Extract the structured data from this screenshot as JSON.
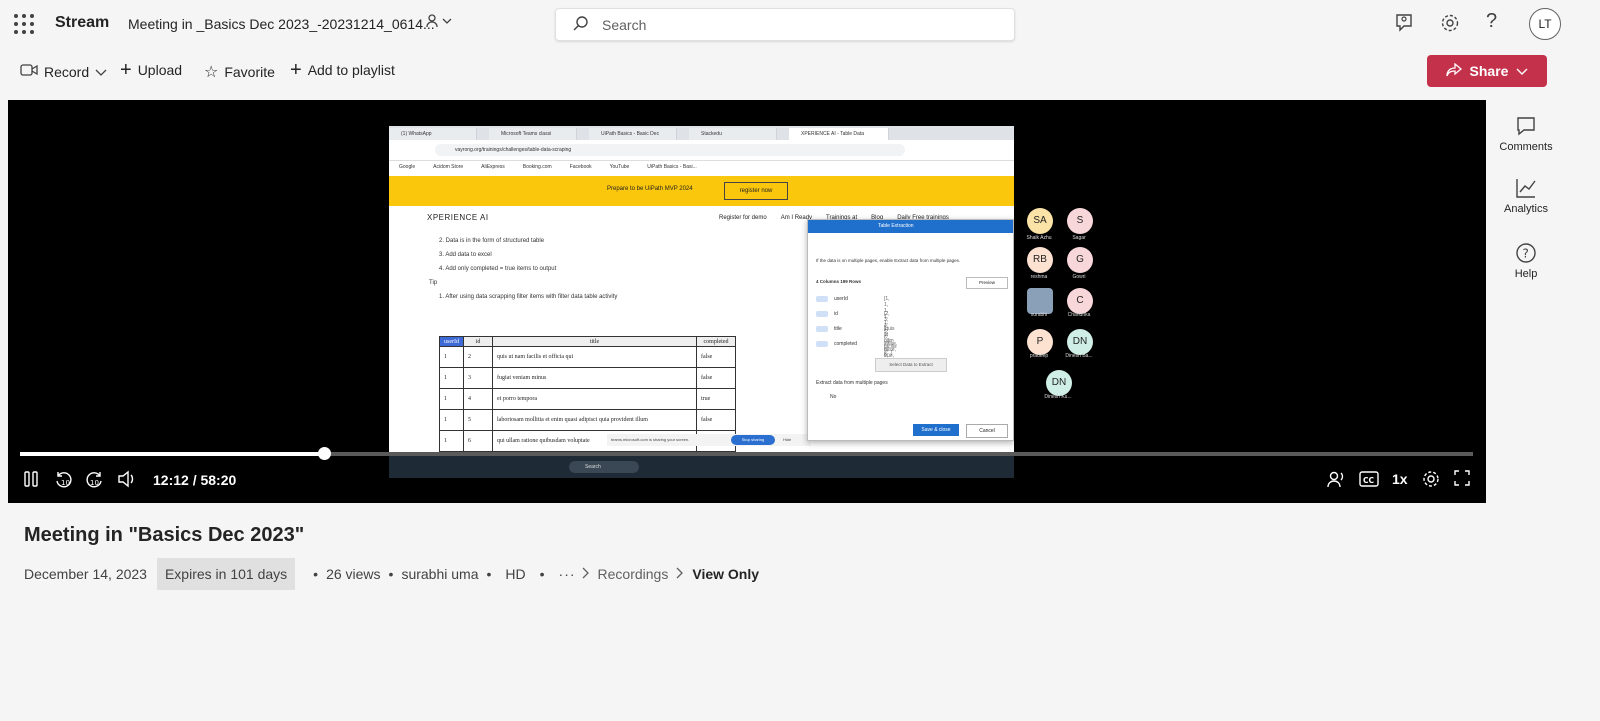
{
  "app": {
    "name": "Stream",
    "doc_title": "Meeting in _Basics Dec 2023_-20231214_0614..."
  },
  "search": {
    "placeholder": "Search"
  },
  "header_icons": [
    "feedback-icon",
    "settings-icon",
    "help-icon"
  ],
  "user": {
    "initials": "LT"
  },
  "commands": {
    "record": "Record",
    "upload": "Upload",
    "favorite": "Favorite",
    "add_to_playlist": "Add to playlist",
    "share": "Share"
  },
  "colors": {
    "share_bg": "#c4314b",
    "player_bg": "#000000",
    "banner": "#fbc70c"
  },
  "shared_screen": {
    "tabs": [
      "(1) WhatsApp",
      "Microsoft Teams classi",
      "UiPath Basics - Basic Dec",
      "Stackedu",
      "XPERIENCE AI - Table Data"
    ],
    "url": "vayrong.org/trainings/challenges/table-data-scraping",
    "bookmarks": [
      "Google",
      "Acidom Store",
      "AliExpress",
      "Booking.com",
      "Facebook",
      "YouTube",
      "UiPath Basics - Basi..."
    ],
    "banner_text": "Prepare to be UiPath MVP 2024",
    "banner_button": "register now",
    "site_logo": "XPERIENCE AI",
    "nav_links": [
      "Register for demo",
      "Am I Ready",
      "Trainings at",
      "Blog",
      "Daily Free trainings"
    ],
    "instructions": [
      "2. Data is in the form of structured table",
      "3. Add data to excel",
      "4. Add only completed = true items to output",
      "Tip",
      "1. After using data scrapping filter items with filter data table activity"
    ],
    "table": {
      "headers": [
        "userId",
        "id",
        "title",
        "completed"
      ],
      "rows": [
        [
          "1",
          "2",
          "quis ut nam facilis et officia qui",
          "false"
        ],
        [
          "1",
          "3",
          "fugiat veniam minus",
          "false"
        ],
        [
          "1",
          "4",
          "et porro tempora",
          "true"
        ],
        [
          "1",
          "5",
          "laboriosam mollitia et enim quasi adipisci quia provident illum",
          "false"
        ],
        [
          "1",
          "6",
          "qui ullam ratione quibusdam voluptate",
          "false"
        ]
      ]
    },
    "teams_share_text": "teams.microsoft.com is sharing your screen.",
    "stop_sharing": "Stop sharing",
    "hide": "Hide",
    "taskbar_search": "Search",
    "dialog": {
      "title": "Table Extraction",
      "note": "If the data is on multiple pages, enable Extract data from multiple pages.",
      "summary": "4 Columns  199 Rows",
      "preview": "Preview",
      "columns": [
        {
          "name": "userId",
          "values": "[1, 1, 1, 1, 1, 1, 1, ...]"
        },
        {
          "name": "id",
          "values": "[2, 3, 4, 5, 6, 7, 8, 9, ...]"
        },
        {
          "name": "title",
          "values": "[quis ut nam facilis e...]"
        },
        {
          "name": "completed",
          "values": "[false, false, true, fals...]"
        }
      ],
      "select_button": "Select Data to Extract",
      "multi_label": "Extract data from multiple pages",
      "toggle_state": "No",
      "save": "Save & close",
      "cancel": "Cancel"
    },
    "participants": [
      {
        "initials": "SA",
        "name": "Shaik Azhu",
        "color": "#fbe3a8"
      },
      {
        "initials": "S",
        "name": "Sagar",
        "color": "#f8d7da"
      },
      {
        "initials": "RB",
        "name": "reshma",
        "color": "#fde2d2"
      },
      {
        "initials": "G",
        "name": "Gowri",
        "color": "#f8d7da"
      },
      {
        "initials": "",
        "name": "surabhi",
        "color": "#8aa0b8"
      },
      {
        "initials": "C",
        "name": "Chandrika",
        "color": "#f8d7da"
      },
      {
        "initials": "P",
        "name": "pradeep",
        "color": "#fde2d2"
      },
      {
        "initials": "DN",
        "name": "Dinesh Ba...",
        "color": "#cfeee5"
      },
      {
        "initials": "DN",
        "name": "Dinesh Ku...",
        "color": "#cfeee5"
      }
    ]
  },
  "player": {
    "time": "12:12 / 58:20",
    "progress": 0.209,
    "speed": "1x"
  },
  "rail": {
    "comments": "Comments",
    "analytics": "Analytics",
    "help": "Help"
  },
  "video": {
    "title": "Meeting in \"Basics Dec 2023\"",
    "date": "December 14, 2023",
    "expires": "Expires in 101 days",
    "views": "26 views",
    "owner": "surabhi uma",
    "quality": "HD",
    "breadcrumb": "Recordings",
    "permission": "View Only"
  }
}
